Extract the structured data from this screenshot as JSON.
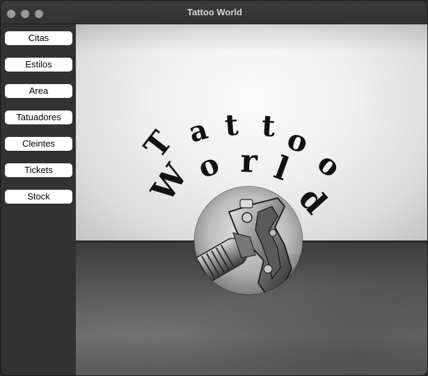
{
  "window": {
    "title": "Tattoo World"
  },
  "sidebar": {
    "items": [
      {
        "label": "Citas"
      },
      {
        "label": "Estilos"
      },
      {
        "label": "Area"
      },
      {
        "label": "Tatuadores"
      },
      {
        "label": "Cleintes"
      },
      {
        "label": "Tickets"
      },
      {
        "label": "Stock"
      }
    ]
  },
  "logo": {
    "word1": [
      "T",
      "a",
      "t",
      "t",
      "o",
      "o"
    ],
    "word2": [
      "W",
      "o",
      "r",
      "l",
      "d"
    ]
  },
  "colors": {
    "window_bg": "#323232",
    "button_bg": "#ffffff",
    "title_text": "#d8d8d8"
  }
}
